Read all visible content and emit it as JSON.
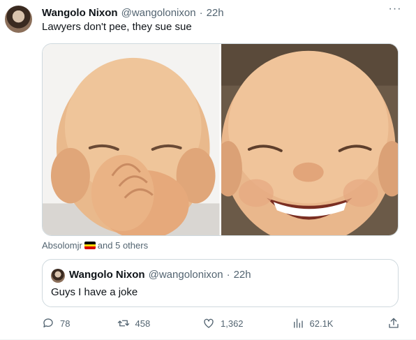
{
  "tweet": {
    "author_name": "Wangolo Nixon",
    "author_handle": "@wangolonixon",
    "separator": "·",
    "time": "22h",
    "more_label": "···",
    "text": "Lawyers don't pee, they sue sue"
  },
  "tagged": {
    "first": "Absolomjr",
    "rest": "and 5 others",
    "flag_colors": [
      "#000000",
      "#fcdc04",
      "#d90000"
    ]
  },
  "quote": {
    "author_name": "Wangolo Nixon",
    "author_handle": "@wangolonixon",
    "separator": "·",
    "time": "22h",
    "text": "Guys I have a joke"
  },
  "actions": {
    "replies": "78",
    "retweets": "458",
    "likes": "1,362",
    "views": "62.1K"
  },
  "colors": {
    "text_primary": "#0f1419",
    "text_secondary": "#536471",
    "border": "#cfd9de"
  }
}
